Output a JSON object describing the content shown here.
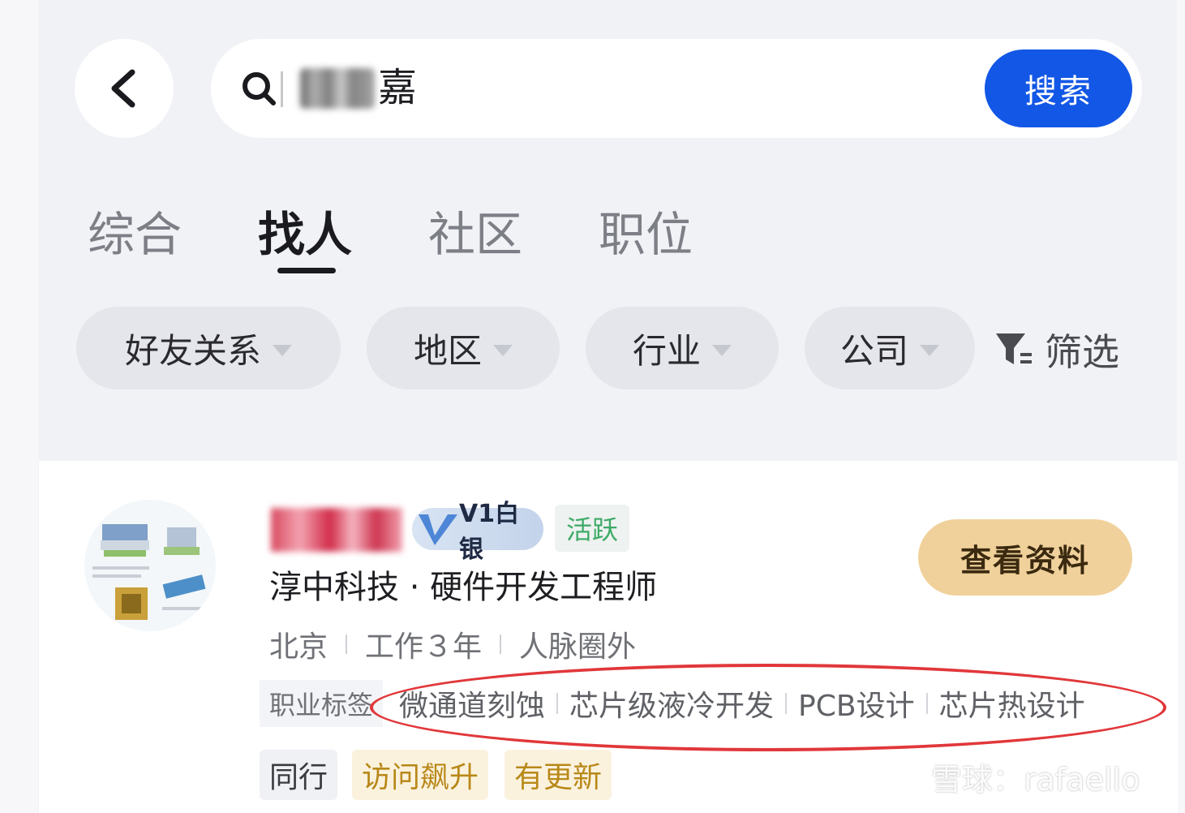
{
  "search": {
    "query_visible": "嘉",
    "button_label": "搜索"
  },
  "tabs": [
    {
      "label": "综合",
      "active": false
    },
    {
      "label": "找人",
      "active": true
    },
    {
      "label": "社区",
      "active": false
    },
    {
      "label": "职位",
      "active": false
    }
  ],
  "filters": {
    "chips": [
      "好友关系",
      "地区",
      "行业",
      "公司"
    ],
    "all_label": "筛选"
  },
  "result": {
    "badge_level": "V1白银",
    "status": "活跃",
    "company_title": "淳中科技 · 硬件开发工程师",
    "meta": [
      "北京",
      "工作３年",
      "人脉圈外"
    ],
    "tags_label": "职业标签",
    "tags": [
      "微通道刻蚀",
      "芯片级液冷开发",
      "PCB设计",
      "芯片热设计"
    ],
    "pills": [
      {
        "label": "同行",
        "style": "gray"
      },
      {
        "label": "访问飙升",
        "style": "gold"
      },
      {
        "label": "有更新",
        "style": "gold"
      }
    ],
    "view_button": "查看资料"
  },
  "watermark": "雪球：rafaello",
  "colors": {
    "primary": "#1357e6",
    "accent_gold": "#f0d19b",
    "active_green": "#3daa67",
    "annotation_red": "#e1373a"
  }
}
